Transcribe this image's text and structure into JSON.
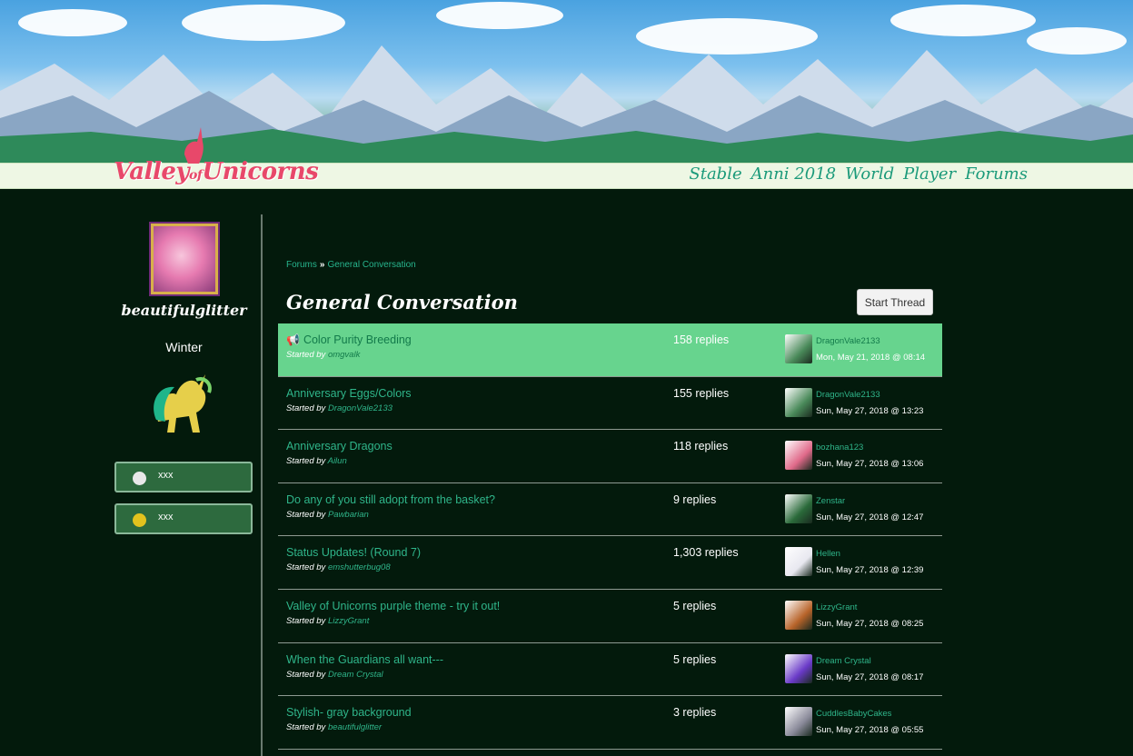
{
  "site": {
    "logo_main": "Valley",
    "logo_of": "of",
    "logo_end": "Unicorns",
    "nav": [
      "Stable",
      "Anni 2018",
      "World",
      "Player",
      "Forums"
    ]
  },
  "sidebar": {
    "username": "beautifulglitter",
    "season": "Winter",
    "currency": [
      {
        "icon": "silver-coin-icon",
        "value": "xxx",
        "color": "#e8e8e8"
      },
      {
        "icon": "gold-coin-icon",
        "value": "xxx",
        "color": "#e2c21e"
      }
    ]
  },
  "main": {
    "breadcrumb": {
      "root": "Forums",
      "sep": "»",
      "current": "General Conversation"
    },
    "title": "General Conversation",
    "start_thread": "Start Thread",
    "threads": [
      {
        "title": "Color Purity Breeding",
        "started_by_label": "Started by",
        "author": "omgvalk",
        "replies": "158 replies",
        "last_user": "DragonVale2133",
        "last_date": "Mon, May 21, 2018 @ 08:14",
        "pinned": true,
        "avatar_color": "#4a8a5a"
      },
      {
        "title": "Anniversary Eggs/Colors",
        "started_by_label": "Started by",
        "author": "DragonVale2133",
        "replies": "155 replies",
        "last_user": "DragonVale2133",
        "last_date": "Sun, May 27, 2018 @ 13:23",
        "pinned": false,
        "avatar_color": "#4a8a5a"
      },
      {
        "title": "Anniversary Dragons",
        "started_by_label": "Started by",
        "author": "Ailun",
        "replies": "118 replies",
        "last_user": "bozhana123",
        "last_date": "Sun, May 27, 2018 @ 13:06",
        "pinned": false,
        "avatar_color": "#e06a8a"
      },
      {
        "title": "Do any of you still adopt from the basket?",
        "started_by_label": "Started by",
        "author": "Pawbarian",
        "replies": "9 replies",
        "last_user": "Zenstar",
        "last_date": "Sun, May 27, 2018 @ 12:47",
        "pinned": false,
        "avatar_color": "#2a6a3a"
      },
      {
        "title": "Status Updates! (Round 7)",
        "started_by_label": "Started by",
        "author": "emshutterbug08",
        "replies": "1,303 replies",
        "last_user": "Hellen",
        "last_date": "Sun, May 27, 2018 @ 12:39",
        "pinned": false,
        "avatar_color": "#e8e8f0"
      },
      {
        "title": "Valley of Unicorns purple theme - try it out!",
        "started_by_label": "Started by",
        "author": "LizzyGrant",
        "replies": "5 replies",
        "last_user": "LizzyGrant",
        "last_date": "Sun, May 27, 2018 @ 08:25",
        "pinned": false,
        "avatar_color": "#b8642a"
      },
      {
        "title": "When the Guardians all want---",
        "started_by_label": "Started by",
        "author": "Dream Crystal",
        "replies": "5 replies",
        "last_user": "Dream Crystal",
        "last_date": "Sun, May 27, 2018 @ 08:17",
        "pinned": false,
        "avatar_color": "#6a3ac8"
      },
      {
        "title": "Stylish- gray background",
        "started_by_label": "Started by",
        "author": "beautifulglitter",
        "replies": "3 replies",
        "last_user": "CuddlesBabyCakes",
        "last_date": "Sun, May 27, 2018 @ 05:55",
        "pinned": false,
        "avatar_color": "#8a8a9a"
      }
    ]
  }
}
